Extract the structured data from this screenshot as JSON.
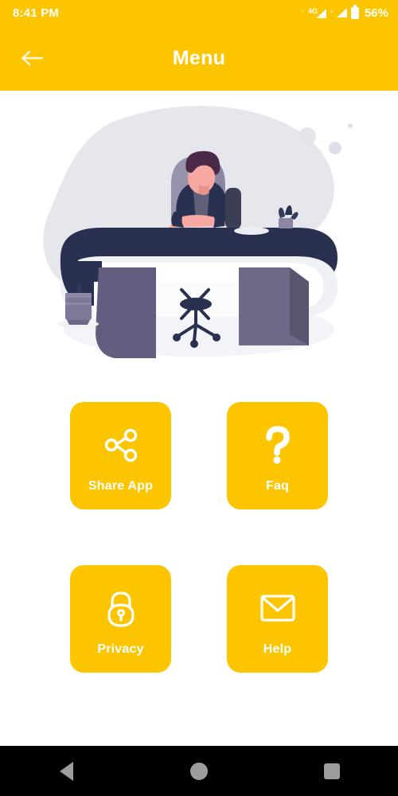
{
  "status_bar": {
    "time": "8:41 PM",
    "network_type": "4G",
    "battery_percent": "56%",
    "icons": [
      "signal-icon",
      "signal-icon",
      "battery-icon"
    ]
  },
  "app_bar": {
    "title": "Menu",
    "back_icon": "arrow-left-icon"
  },
  "illustration": {
    "name": "person-at-desk-illustration",
    "alt": "Illustration of a person working at a curved desk with a chair and plants"
  },
  "menu": {
    "tiles": [
      {
        "label": "Share App",
        "icon": "share-icon",
        "name": "menu-tile-share-app"
      },
      {
        "label": "Faq",
        "icon": "question-icon",
        "name": "menu-tile-faq"
      },
      {
        "label": "Privacy",
        "icon": "lock-icon",
        "name": "menu-tile-privacy"
      },
      {
        "label": "Help",
        "icon": "envelope-icon",
        "name": "menu-tile-help"
      }
    ]
  },
  "nav_bar": {
    "buttons": [
      "back-triangle-icon",
      "home-circle-icon",
      "recents-square-icon"
    ]
  },
  "colors": {
    "accent": "#FDC500",
    "on_accent": "#FFFFFF",
    "background": "#FFFFFF",
    "nav_bar": "#000000",
    "nav_icon": "#9D9D9D",
    "illustration_dark": "#2A3050",
    "illustration_grey": "#E4E6EC",
    "illustration_purple": "#635E80"
  }
}
